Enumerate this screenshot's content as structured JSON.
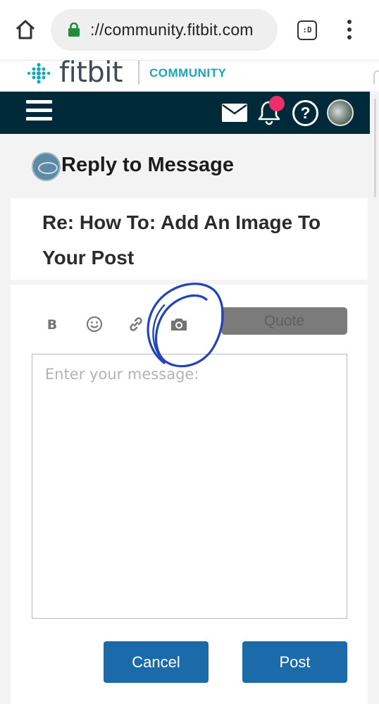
{
  "browser": {
    "url": "://community.fitbit.com",
    "tab_switcher_label": ":D"
  },
  "site": {
    "logo_text": "fitbit",
    "logo_subtitle": "COMMUNITY"
  },
  "page": {
    "heading": "Reply to Message",
    "subject": "Re: How To: Add An Image To Your Post"
  },
  "editor": {
    "bold_label": "B",
    "quote_label": "Quote",
    "message_placeholder": "Enter your message:",
    "cancel_label": "Cancel",
    "post_label": "Post"
  },
  "colors": {
    "nav_background": "#002a3a",
    "accent_teal": "#19a7b3",
    "button_blue": "#1b6aaa",
    "notification_pink": "#ec2f68",
    "annotation_ink": "#2244b8"
  },
  "icons": [
    "home-icon",
    "lock-icon",
    "kebab-menu-icon",
    "hamburger-menu-icon",
    "mail-icon",
    "bell-icon",
    "help-icon",
    "emoji-icon",
    "link-icon",
    "camera-icon"
  ]
}
